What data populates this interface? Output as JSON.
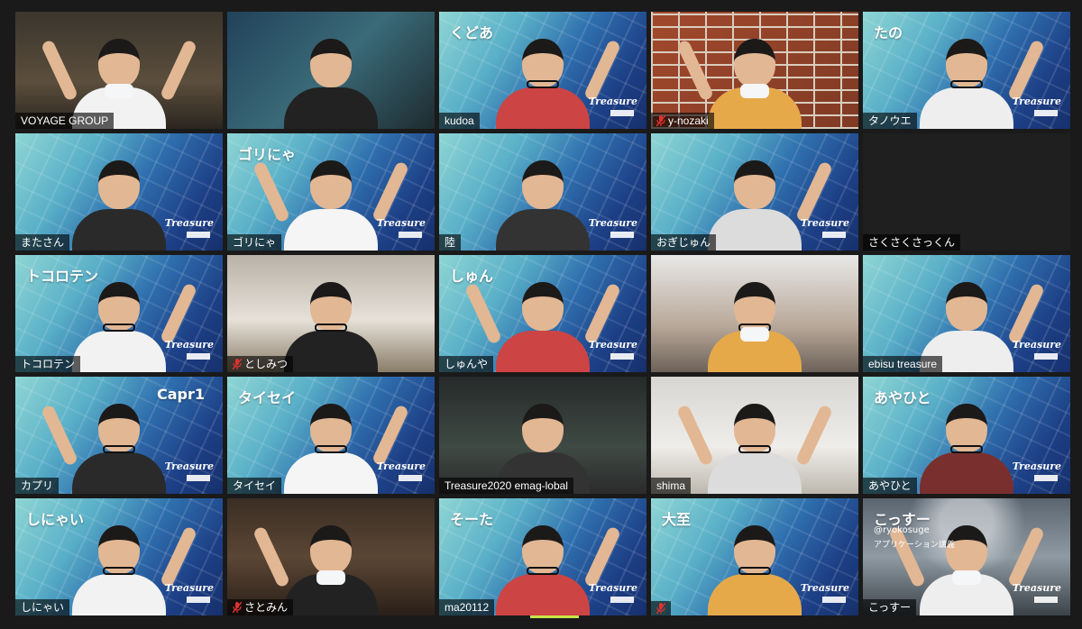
{
  "colors": {
    "active_speaker_outline": "#c8e44a",
    "name_tag_bg": "rgba(0,0,0,0.62)",
    "muted_icon": "#e0322f"
  },
  "tiles": [
    {
      "name": "VOYAGE GROUP",
      "muted": false,
      "bg": "room",
      "bg_text": ""
    },
    {
      "name": "",
      "muted": false,
      "bg": "tropical",
      "bg_text": ""
    },
    {
      "name": "kudoa",
      "muted": false,
      "bg": "treasure",
      "bg_text": "くどあ"
    },
    {
      "name": "y-nozaki",
      "muted": true,
      "bg": "brick",
      "bg_text": ""
    },
    {
      "name": "タノウエ",
      "muted": false,
      "bg": "treasure",
      "bg_text": "たの"
    },
    {
      "name": "またさん",
      "muted": false,
      "bg": "treasure",
      "bg_text": ""
    },
    {
      "name": "ゴリにゃ",
      "muted": false,
      "bg": "treasure",
      "bg_text": "ゴリにゃ"
    },
    {
      "name": "陸",
      "muted": false,
      "bg": "treasure",
      "bg_text": ""
    },
    {
      "name": "おぎじゅん",
      "muted": false,
      "bg": "treasure",
      "bg_text": ""
    },
    {
      "name": "さくさくさっくん",
      "muted": false,
      "bg": "dark",
      "bg_text": ""
    },
    {
      "name": "トコロテン",
      "muted": false,
      "bg": "treasure",
      "bg_text": "トコロテン"
    },
    {
      "name": "としみつ",
      "muted": true,
      "bg": "office",
      "bg_text": ""
    },
    {
      "name": "しゅんや",
      "muted": false,
      "bg": "treasure",
      "bg_text": "しゅん"
    },
    {
      "name": "",
      "muted": false,
      "bg": "gym",
      "bg_text": ""
    },
    {
      "name": "ebisu treasure",
      "muted": false,
      "bg": "treasure",
      "bg_text": ""
    },
    {
      "name": "カプリ",
      "muted": false,
      "bg": "treasure",
      "bg_text": "Capr1"
    },
    {
      "name": "タイセイ",
      "muted": false,
      "bg": "treasure",
      "bg_text": "タイセイ"
    },
    {
      "name": "Treasure2020 emag-lobal",
      "muted": false,
      "bg": "studio",
      "bg_text": "",
      "active": true
    },
    {
      "name": "shima",
      "muted": false,
      "bg": "white",
      "bg_text": ""
    },
    {
      "name": "あやひと",
      "muted": false,
      "bg": "treasure",
      "bg_text": "あやひと"
    },
    {
      "name": "しにゃい",
      "muted": false,
      "bg": "treasure",
      "bg_text": "しにゃい"
    },
    {
      "name": "さとみん",
      "muted": true,
      "bg": "elevator",
      "bg_text": ""
    },
    {
      "name": "ma20112",
      "muted": false,
      "bg": "treasure",
      "bg_text": "そーた"
    },
    {
      "name": "",
      "muted": true,
      "bg": "treasure",
      "bg_text": "大至"
    },
    {
      "name": "こっすー",
      "muted": false,
      "bg": "hall",
      "bg_text": "こっすー",
      "sub1": "@ryokosuge",
      "sub2": "アプリケーション講義"
    }
  ],
  "logo_text": "Treasure"
}
